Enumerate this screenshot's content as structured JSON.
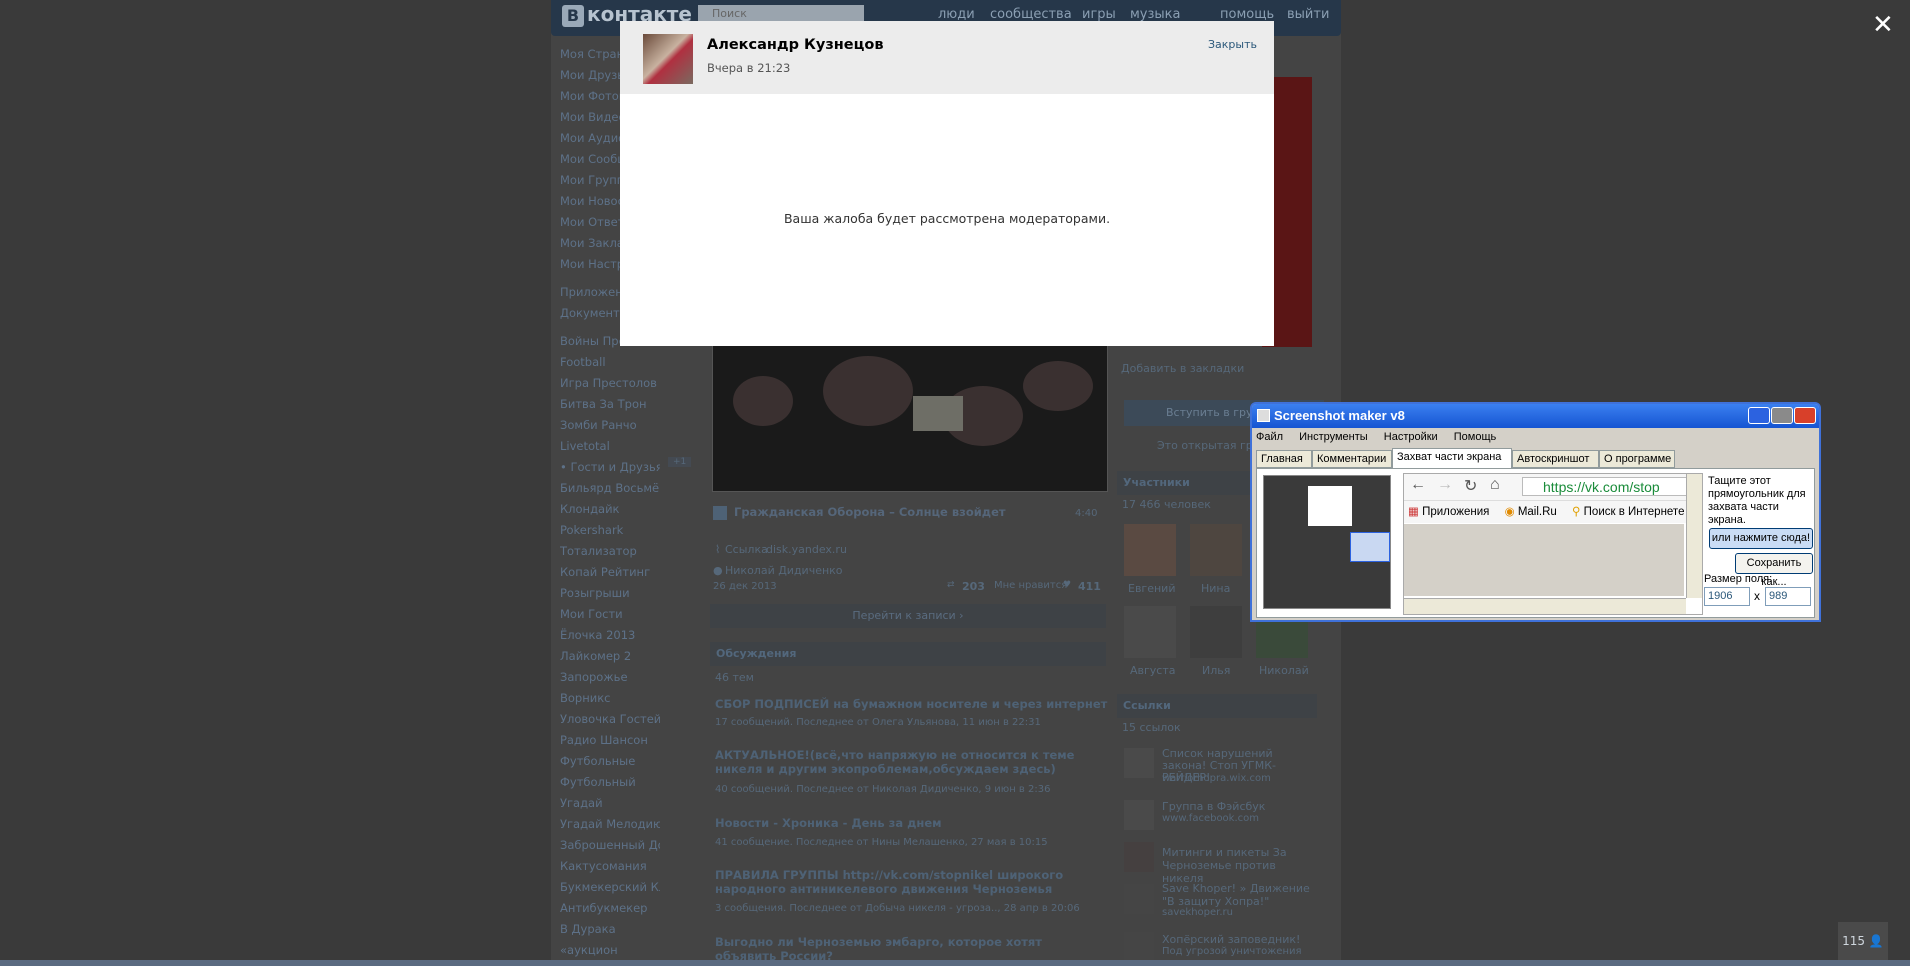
{
  "header": {
    "logo": "контакте",
    "logo_letter": "В",
    "search_placeholder": "Поиск",
    "nav": [
      "люди",
      "сообщества",
      "игры",
      "музыка",
      "помощь",
      "выйти"
    ]
  },
  "left_menu": {
    "main": [
      "Моя Страница",
      "Мои Друзья",
      "Мои Фотографии",
      "Мои Видеозаписи",
      "Мои Аудиозаписи",
      "Мои Сообщения",
      "Мои Группы",
      "Мои Новости",
      "Мои Ответы",
      "Мои Закладки",
      "Мои Настройки"
    ],
    "apps": [
      "Приложения",
      "Документы"
    ],
    "games": [
      "Войны Престолов",
      "Football",
      "Игра Престолов",
      "Битва За Трон",
      "Зомби Ранчо",
      "Livetotal",
      "• Гости и Друзья",
      "Бильярд Восьмёрка",
      "Клондайк",
      "Pokershark",
      "Тотализатор",
      "Копай Рейтинг",
      "Розыгрыши",
      "Мои Гости",
      "Ёлочка 2013",
      "Лайкомер 2",
      "Запорожье",
      "Ворникс",
      "Уловочка Гостей",
      "Радио Шансон",
      "Футбольные",
      "Футбольный",
      "Угадай",
      "Угадай Мелодию",
      "Заброшенный Дом",
      "Кактусомания",
      "Букмекерский Клуб",
      "Антибукмекер",
      "В Дурака",
      "«аукцион"
    ],
    "guests_badge": "+1"
  },
  "post": {
    "track": "Гражданская Оборона – Солнце взойдет",
    "duration": "4:40",
    "link_label": "Ссылка",
    "link": "disk.yandex.ru",
    "author": "Николай Дидиченко",
    "date": "26 дек 2013",
    "reposts": "203",
    "likes_label": "Мне нравится",
    "likes": "411",
    "goto": "Перейти к записи"
  },
  "discussions": {
    "title": "Обсуждения",
    "count": "46 тем",
    "topics": [
      {
        "title": "СБОР ПОДПИСЕЙ на бумажном носителе и через интернет",
        "meta": "17 сообщений. Последнее от Олега Ульянова, 11 июн в 22:31"
      },
      {
        "title": "АКТУАЛЬНОЕ!(всё,что напряжую не относится к теме никеля и другим экопроблемам,обсуждаем здесь)",
        "meta": "40 сообщений. Последнее от Николая Дидиченко, 9 июн в 2:36"
      },
      {
        "title": "Новости - Хроника - День за днем",
        "meta": "41 сообщение. Последнее от Нины Мелашенко, 27 мая в 10:15"
      },
      {
        "title": "ПРАВИЛА ГРУППЫ http://vk.com/stopnikel широкого народного антиникелевого движения Черноземья",
        "meta": "3 сообщения. Последнее от Добыча никеля - угроза.., 28 апр в 20:06"
      },
      {
        "title": "Выгодно ли Черноземью эмбарго, которое хотят объявить России?",
        "meta": ""
      }
    ]
  },
  "right_col": {
    "bookmark": "Добавить в закладки",
    "join": "Вступить в группу",
    "open_group": "Это открытая группа",
    "members_title": "Участники",
    "members_count": "17 466 человек",
    "members": [
      "Евгений",
      "Нина",
      "Августа",
      "Илья",
      "Николай"
    ],
    "links_title": "Ссылки",
    "links_count": "15 ссылок",
    "links": [
      {
        "title": "Список нарушений закона! Стоп УГМК-РЕЙДЕР!",
        "url": "warriorhopra.wix.com"
      },
      {
        "title": "Группа в Фэйсбук",
        "url": "www.facebook.com"
      },
      {
        "title": "Митинги и пикеты За Черноземье против никеля",
        "url": ""
      },
      {
        "title": "Save Khoper! » Движение \"В защиту Хопра!\"",
        "url": "savekhoper.ru"
      },
      {
        "title": "Хопёрский заповедник!",
        "url": "Под угрозой уничтожения"
      }
    ]
  },
  "modal": {
    "name": "Александр Кузнецов",
    "time": "Вчера в 21:23",
    "close": "Закрыть",
    "message": "Ваша жалоба будет рассмотрена модераторами."
  },
  "overlay_close": "✕",
  "screenshot_maker": {
    "title": "Screenshot maker v8",
    "menu": [
      "Файл",
      "Инструменты",
      "Настройки",
      "Помощь"
    ],
    "tabs": [
      "Главная",
      "Комментарии",
      "Захват части экрана",
      "Автоскриншот",
      "О программе"
    ],
    "active_tab": "Захват части экрана",
    "browser_url": "https://vk.com/stop",
    "bookmarks": [
      "Приложения",
      "Mail.Ru",
      "Поиск в Интернете"
    ],
    "hint": "Тащите этот прямоугольник для захвата части экрана.",
    "click_here": "или нажмите сюда!",
    "save_as": "Сохранить как...",
    "size_label": "Размер поля:",
    "width": "1906",
    "height": "989",
    "times": "x"
  },
  "online_badge": "115"
}
